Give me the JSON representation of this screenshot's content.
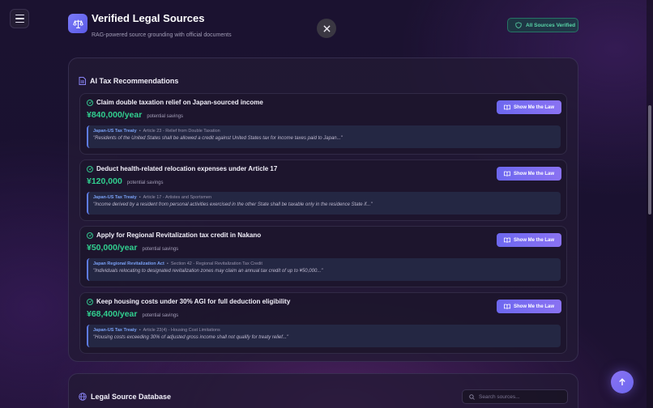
{
  "header": {
    "title": "Verified Legal Sources",
    "subtitle": "RAG-powered source grounding with official documents",
    "badge": "All Sources Verified"
  },
  "recommendations": {
    "section_title": "AI Tax Recommendations",
    "button_label": "Show Me the Law",
    "amount_label": "potential savings",
    "items": [
      {
        "title": "Claim double taxation relief on Japan-sourced income",
        "amount": "¥840,000/year",
        "source": "Japan-US Tax Treaty",
        "article": "Article 23 - Relief from Double Taxation",
        "quote": "\"Residents of the United States shall be allowed a credit against United States tax for income taxes paid to Japan...\""
      },
      {
        "title": "Deduct health-related relocation expenses under Article 17",
        "amount": "¥120,000",
        "source": "Japan-US Tax Treaty",
        "article": "Article 17 - Artistes and Sportsmen",
        "quote": "\"Income derived by a resident from personal activities exercised in the other State shall be taxable only in the residence State if...\""
      },
      {
        "title": "Apply for Regional Revitalization tax credit in Nakano",
        "amount": "¥50,000/year",
        "source": "Japan Regional Revitalization Act",
        "article": "Section 42 - Regional Revitalization Tax Credit",
        "quote": "\"Individuals relocating to designated revitalization zones may claim an annual tax credit of up to ¥50,000...\""
      },
      {
        "title": "Keep housing costs under 30% AGI for full deduction eligibility",
        "amount": "¥68,400/year",
        "source": "Japan-US Tax Treaty",
        "article": "Article 23(4) - Housing Cost Limitations",
        "quote": "\"Housing costs exceeding 30% of adjusted gross income shall not qualify for treaty relief...\""
      }
    ]
  },
  "database": {
    "section_title": "Legal Source Database",
    "search_placeholder": "Search sources..."
  },
  "colors": {
    "accent": "#6d68f0",
    "success": "#31cf8f",
    "source_link": "#7aa0f5"
  }
}
